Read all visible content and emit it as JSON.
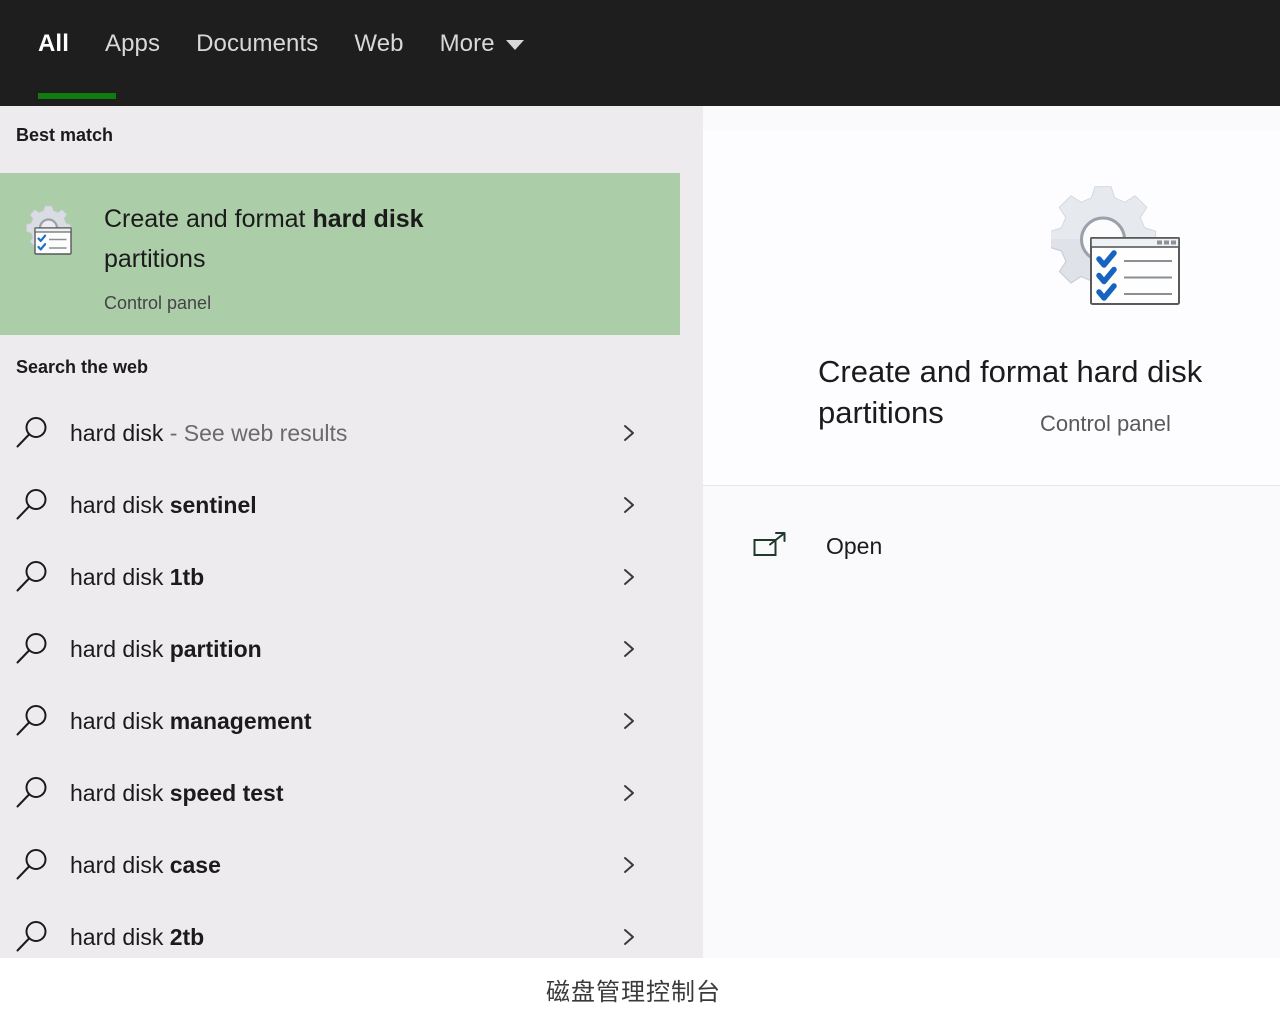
{
  "window": {
    "title": "Windows Search",
    "accent_green": "#107c10",
    "highlight_green": "#abcda8",
    "tabbar_bg": "#1e1e1e",
    "left_panel_bg": "#edebee",
    "right_panel_bg": "#faf9fb"
  },
  "tabbar": {
    "tabs": [
      {
        "label": "All",
        "active": true
      },
      {
        "label": "Apps",
        "active": false
      },
      {
        "label": "Documents",
        "active": false
      },
      {
        "label": "Web",
        "active": false
      },
      {
        "label": "More",
        "active": false,
        "has_caret": true
      }
    ],
    "caret_icon": "chevron-down-icon"
  },
  "results": {
    "best_match_heading": "Best match",
    "best_match": {
      "icon": "disk-management-icon",
      "title_prefix": "Create and format ",
      "title_highlight": "hard disk",
      "title_suffix": "partitions",
      "subtitle": "Control panel"
    },
    "web_heading": "Search the web",
    "web_items": [
      {
        "icon": "search-icon",
        "query": "hard disk",
        "bold": "",
        "suffix": " - See web results",
        "chevron": "chevron-right-icon"
      },
      {
        "icon": "search-icon",
        "query": "hard disk ",
        "bold": "sentinel",
        "suffix": "",
        "chevron": "chevron-right-icon"
      },
      {
        "icon": "search-icon",
        "query": "hard disk ",
        "bold": "1tb",
        "suffix": "",
        "chevron": "chevron-right-icon"
      },
      {
        "icon": "search-icon",
        "query": "hard disk ",
        "bold": "partition",
        "suffix": "",
        "chevron": "chevron-right-icon"
      },
      {
        "icon": "search-icon",
        "query": "hard disk ",
        "bold": "management",
        "suffix": "",
        "chevron": "chevron-right-icon"
      },
      {
        "icon": "search-icon",
        "query": "hard disk ",
        "bold": "speed test",
        "suffix": "",
        "chevron": "chevron-right-icon"
      },
      {
        "icon": "search-icon",
        "query": "hard disk ",
        "bold": "case",
        "suffix": "",
        "chevron": "chevron-right-icon"
      },
      {
        "icon": "search-icon",
        "query": "hard disk ",
        "bold": "2tb",
        "suffix": "",
        "chevron": "chevron-right-icon"
      }
    ]
  },
  "preview": {
    "icon": "disk-management-icon",
    "title": "Create and format hard disk partitions",
    "subtitle": "Control panel",
    "actions": [
      {
        "icon": "open-in-new-icon",
        "label": "Open"
      }
    ]
  },
  "caption": {
    "text": "磁盘管理控制台"
  }
}
